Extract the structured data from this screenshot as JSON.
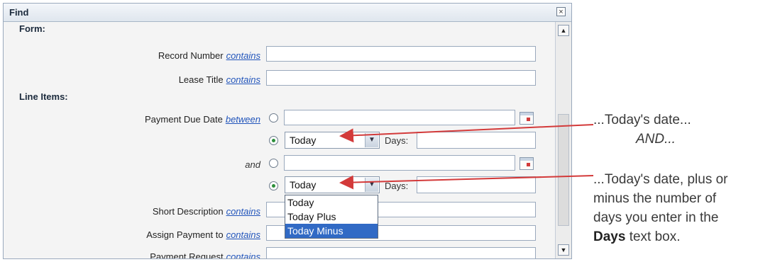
{
  "dialog": {
    "title": "Find",
    "close_symbol": "×",
    "sections": {
      "form": "Form:",
      "line_items": "Line Items:"
    },
    "fields": {
      "record_number": {
        "label": "Record Number",
        "operator": "contains",
        "value": ""
      },
      "lease_title": {
        "label": "Lease Title",
        "operator": "contains",
        "value": ""
      },
      "payment_due_date": {
        "label": "Payment Due Date",
        "operator": "between"
      },
      "and_label": "and",
      "short_description": {
        "label": "Short Description",
        "operator": "contains",
        "value": ""
      },
      "assign_payment_to": {
        "label": "Assign Payment to",
        "operator": "contains",
        "value": ""
      },
      "payment_request": {
        "label": "Payment Request",
        "operator": "contains",
        "value": ""
      }
    },
    "date_from": {
      "relative_value": "Today",
      "days_label": "Days:",
      "days_value": "",
      "date_value": ""
    },
    "date_to": {
      "relative_value": "Today",
      "days_label": "Days:",
      "days_value": "",
      "date_value": ""
    },
    "dropdown_options": [
      "Today",
      "Today Plus",
      "Today Minus"
    ],
    "dropdown_selected": "Today Minus",
    "scroll_up_symbol": "▲",
    "scroll_down_symbol": "▼",
    "select_arrow": "▼"
  },
  "annotations": {
    "note1_line1": "...Today's date...",
    "note1_line2": "AND...",
    "note2_line1": "...Today's date, plus or",
    "note2_line2": "minus the number of",
    "note2_line3": "days you enter in the",
    "note2_line4_bold": "Days",
    "note2_line4_rest": " text box."
  },
  "colors": {
    "arrow": "#d33a3a",
    "accent": "#316ac5",
    "link": "#2255bb"
  }
}
